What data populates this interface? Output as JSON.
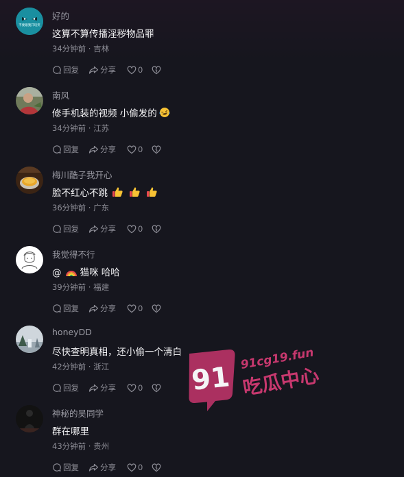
{
  "actions": {
    "reply": "回复",
    "share": "分享"
  },
  "watermark": {
    "number": "91",
    "domain": "91cg19.fun",
    "name": "吃瓜中心"
  },
  "comments": [
    {
      "avatar_text": "不要跟我开玩笑",
      "user": "好的",
      "text": "这算不算传播淫秽物品罪",
      "meta": "34分钟前 · 吉林",
      "likes": "0"
    },
    {
      "user": "南风",
      "text": "修手机装的视频 小偷发的",
      "meta": "34分钟前 · 江苏",
      "likes": "0"
    },
    {
      "user": "梅川酷子我开心",
      "text": "脸不红心不跳",
      "meta": "36分钟前 · 广东",
      "likes": "0"
    },
    {
      "user": "我觉得不行",
      "text": "@",
      "mention": "猫咪 哈哈",
      "meta": "39分钟前 · 福建",
      "likes": "0"
    },
    {
      "user": "honeyDD",
      "text": "尽快查明真相，还小偷一个清白",
      "meta": "42分钟前 · 浙江",
      "likes": "0"
    },
    {
      "user": "神秘的吴同学",
      "text": "群在哪里",
      "meta": "43分钟前 · 贵州",
      "likes": "0"
    }
  ]
}
